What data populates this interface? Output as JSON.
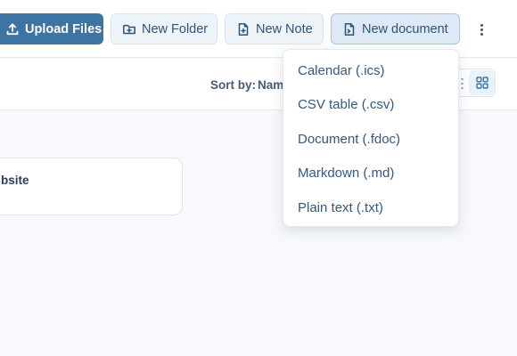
{
  "toolbar": {
    "upload_label": "Upload Files",
    "new_folder_label": "New Folder",
    "new_note_label": "New Note",
    "new_document_label": "New document"
  },
  "sort": {
    "label": "Sort by:",
    "value": "Nam"
  },
  "card": {
    "title": "bsite"
  },
  "dropdown": {
    "items": [
      {
        "label": "Calendar (.ics)"
      },
      {
        "label": "CSV table (.csv)"
      },
      {
        "label": "Document (.fdoc)"
      },
      {
        "label": "Markdown (.md)"
      },
      {
        "label": "Plain text (.txt)"
      }
    ]
  },
  "icons": {
    "upload": "upload-icon",
    "folder_plus": "folder-plus-icon",
    "note_plus": "file-plus-icon",
    "document_plus": "file-plus-icon",
    "more": "more-vertical-icon",
    "list_view": "list-view-icon",
    "grid_view": "grid-view-icon"
  },
  "colors": {
    "primary": "#3d74a3",
    "accent_text": "#2f5478",
    "menu_text": "#35587c"
  }
}
